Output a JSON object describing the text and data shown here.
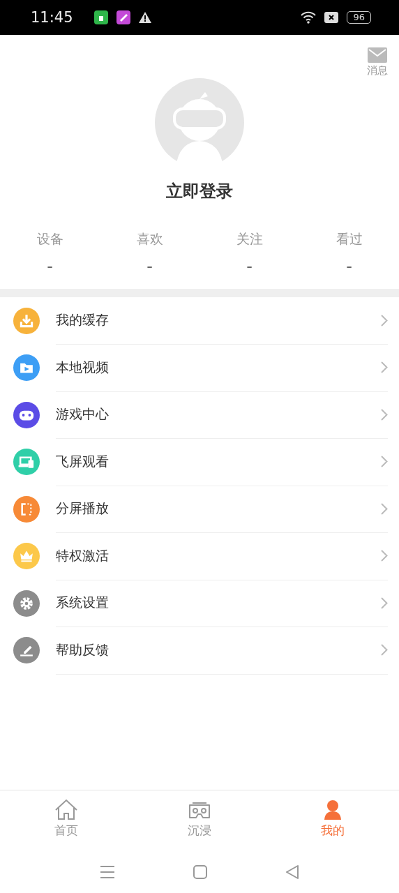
{
  "status_bar": {
    "time": "11:45",
    "battery": "96"
  },
  "header": {
    "message_label": "消息",
    "login": "立即登录"
  },
  "stats": [
    {
      "label": "设备",
      "value": "-"
    },
    {
      "label": "喜欢",
      "value": "-"
    },
    {
      "label": "关注",
      "value": "-"
    },
    {
      "label": "看过",
      "value": "-"
    }
  ],
  "menu": [
    {
      "kind": "download",
      "label": "我的缓存",
      "color": "#f7b23b"
    },
    {
      "kind": "folder",
      "label": "本地视频",
      "color": "#3d9ef5"
    },
    {
      "kind": "gamepad",
      "label": "游戏中心",
      "color": "#5b4ce6"
    },
    {
      "kind": "devices",
      "label": "飞屏观看",
      "color": "#2fcfa8"
    },
    {
      "kind": "split",
      "label": "分屏播放",
      "color": "#f78a37"
    },
    {
      "kind": "crown",
      "label": "特权激活",
      "color": "#fcc84a"
    },
    {
      "kind": "gear",
      "label": "系统设置",
      "color": "#8c8c8c"
    },
    {
      "kind": "pen",
      "label": "帮助反馈",
      "color": "#8c8c8c"
    }
  ],
  "tabs": [
    {
      "kind": "home",
      "label": "首页",
      "selected": false
    },
    {
      "kind": "vr",
      "label": "沉浸",
      "selected": false
    },
    {
      "kind": "person",
      "label": "我的",
      "selected": true
    }
  ]
}
